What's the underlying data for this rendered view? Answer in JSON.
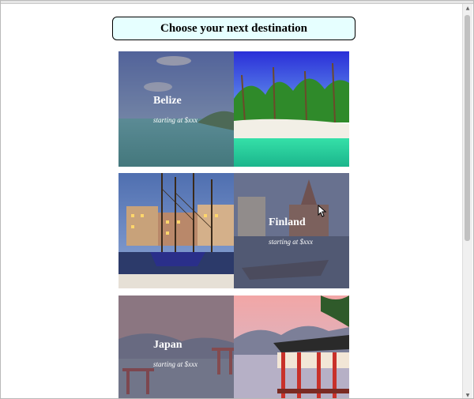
{
  "header": {
    "title": "Choose your next destination"
  },
  "cards": [
    {
      "name": "Belize",
      "subtitle": "starting at $xxx",
      "overlay_side": "left"
    },
    {
      "name": "Finland",
      "subtitle": "starting at $xxx",
      "overlay_side": "right"
    },
    {
      "name": "Japan",
      "subtitle": "starting at $xxx",
      "overlay_side": "left"
    }
  ],
  "colors": {
    "header_bg": "#e6ffff",
    "overlay": "rgba(90,90,110,0.55)",
    "text": "#ffffff"
  },
  "icons": {
    "scroll_up": "triangle-up-icon",
    "scroll_down": "triangle-down-icon",
    "cursor": "mouse-pointer-icon"
  }
}
